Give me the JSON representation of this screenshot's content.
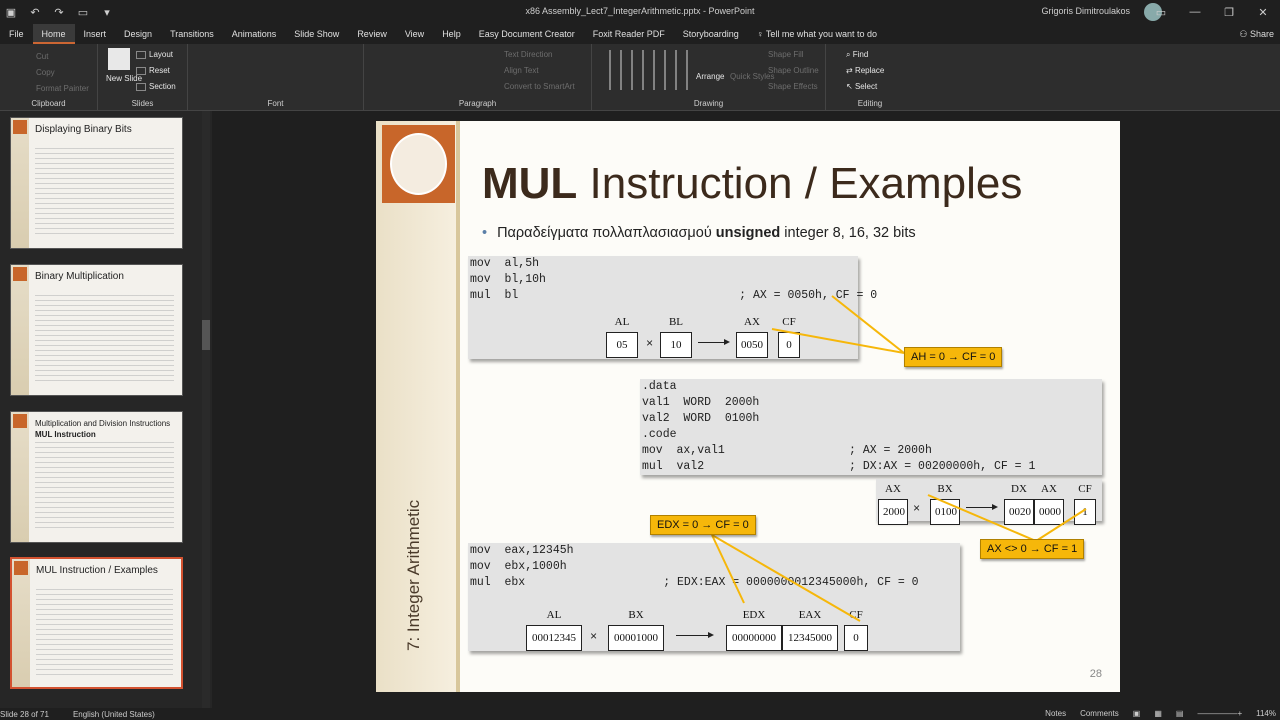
{
  "window": {
    "title": "x86 Assembly_Lect7_IntegerArithmetic.pptx  -  PowerPoint",
    "user": "Grigoris Dimitroulakos"
  },
  "tabs": [
    "File",
    "Home",
    "Insert",
    "Design",
    "Transitions",
    "Animations",
    "Slide Show",
    "Review",
    "View",
    "Help",
    "Easy Document Creator",
    "Foxit Reader PDF",
    "Storyboarding"
  ],
  "tell_me": "Tell me what you want to do",
  "share": "Share",
  "ribbon": {
    "groups": {
      "clipboard": "Clipboard",
      "slides": "Slides",
      "font": "Font",
      "paragraph": "Paragraph",
      "drawing": "Drawing",
      "editing": "Editing"
    },
    "new_slide": "New Slide",
    "layout": "Layout",
    "reset": "Reset",
    "section": "Section",
    "arrange": "Arrange",
    "find": "Find",
    "replace": "Replace",
    "select": "Select",
    "text_direction": "Text Direction",
    "align_text": "Align Text",
    "convert_smartart": "Convert to SmartArt",
    "shape_fill": "Shape Fill",
    "shape_outline": "Shape Outline",
    "shape_effects": "Shape Effects",
    "quick_styles": "Quick Styles",
    "cut": "Cut",
    "copy": "Copy",
    "format_painter": "Format Painter"
  },
  "thumbnails": [
    {
      "title": "Displaying Binary Bits"
    },
    {
      "title": "Binary Multiplication"
    },
    {
      "title": "Multiplication and Division Instructions",
      "title2": "MUL Instruction"
    },
    {
      "title": "MUL Instruction / Examples"
    }
  ],
  "slide": {
    "title_bold": "MUL",
    "title_rest": " Instruction / Examples",
    "bullet_pre": "Παραδείγματα πολλαπλασιασμού ",
    "bullet_bold": "unsigned",
    "bullet_post": " integer 8, 16, 32 bits",
    "side_label": "7: Integer Arithmetic",
    "page": "28",
    "box1": {
      "code": "mov  al,5h\nmov  bl,10h\nmul  bl                                ; AX = 0050h, CF = 0",
      "cells": [
        {
          "label": "AL",
          "value": "05"
        },
        {
          "label": "BL",
          "value": "10"
        },
        {
          "label": "AX",
          "value": "0050"
        },
        {
          "label": "CF",
          "value": "0"
        }
      ]
    },
    "box2": {
      "code": ".data\nval1  WORD  2000h\nval2  WORD  0100h\n.code\nmov  ax,val1                  ; AX = 2000h\nmul  val2                     ; DX:AX = 00200000h, CF = 1",
      "cells": [
        {
          "label": "AX",
          "value": "2000"
        },
        {
          "label": "BX",
          "value": "0100"
        },
        {
          "label": "DX",
          "value": "0020"
        },
        {
          "label": "AX",
          "value": "0000"
        },
        {
          "label": "CF",
          "value": "1"
        }
      ]
    },
    "box3": {
      "code": "mov  eax,12345h\nmov  ebx,1000h\nmul  ebx                    ; EDX:EAX = 0000000012345000h, CF = 0",
      "cells": [
        {
          "label": "AL",
          "value": "00012345"
        },
        {
          "label": "BX",
          "value": "00001000"
        },
        {
          "label": "EDX",
          "value": "00000000"
        },
        {
          "label": "EAX",
          "value": "12345000"
        },
        {
          "label": "CF",
          "value": "0"
        }
      ]
    },
    "times": "×",
    "callouts": {
      "c1": "AH = 0 → CF = 0",
      "c2": "EDX = 0 → CF = 0",
      "c3": "AX <> 0 → CF = 1"
    }
  },
  "status": {
    "slide_of": "Slide 28 of 71",
    "language": "English (United States)",
    "notes": "Notes",
    "comments": "Comments",
    "zoom": "114%"
  },
  "colors": {
    "accent": "#d35230",
    "callout": "#f6b70a",
    "codebox": "#e3e3e3"
  }
}
